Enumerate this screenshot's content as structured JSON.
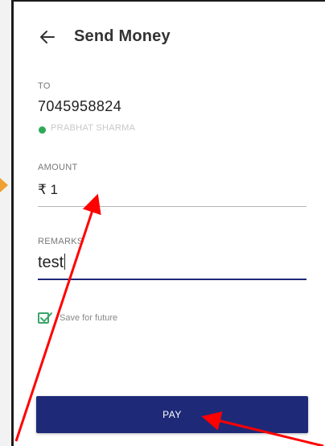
{
  "header": {
    "title": "Send Money",
    "back_icon": "arrow-left-icon"
  },
  "recipient": {
    "label": "TO",
    "phone": "7045958824",
    "name": "PRABHAT SHARMA",
    "status_color": "#2fa85a"
  },
  "amount": {
    "label": "AMOUNT",
    "value": "₹ 1"
  },
  "remarks": {
    "label": "REMARKS",
    "value": "test"
  },
  "save_for_future": {
    "label": "Save for future",
    "checked": true
  },
  "pay_button": {
    "label": "PAY",
    "color": "#1e2a78"
  },
  "annotations": {
    "arrow_color": "#ff0000"
  }
}
